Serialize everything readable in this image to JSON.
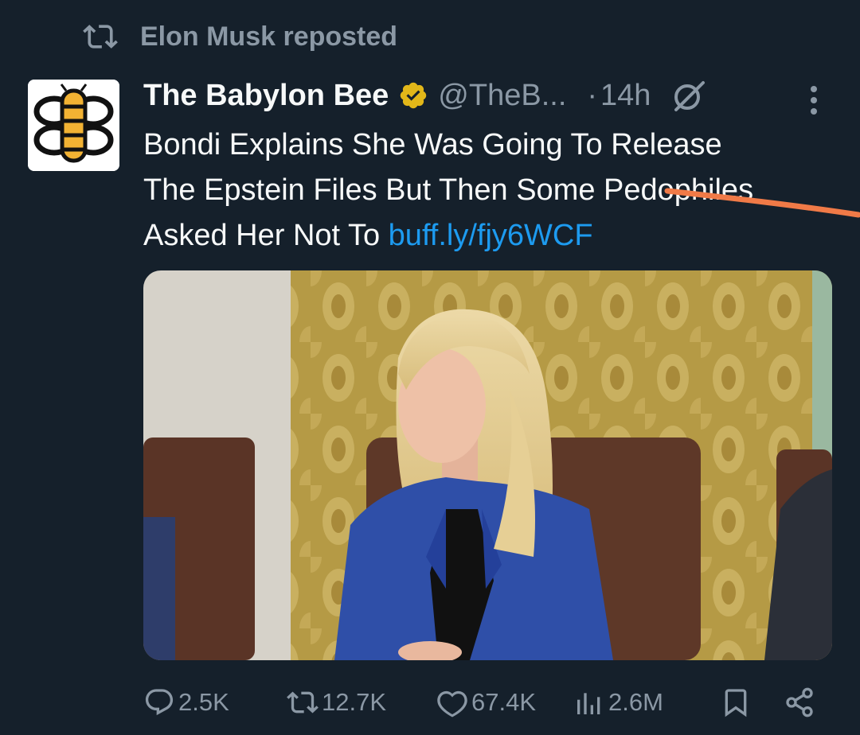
{
  "repost": {
    "icon": "repost-icon",
    "text": "Elon Musk reposted"
  },
  "tweet": {
    "avatar_icon": "babylon-bee-logo",
    "display_name": "The Babylon Bee",
    "verified_icon": "verified-gold-badge",
    "handle": "@TheB...",
    "dot": "·",
    "time": "14h",
    "grok_icon": "grok-icon",
    "more_icon": "more-vertical-icon",
    "text_lines": [
      "Bondi Explains She Was Going To Release",
      "The Epstein Files But Then Some Pedophiles",
      "Asked Her Not To"
    ],
    "link": "buff.ly/fjy6WCF",
    "media_alt_icon": "photo",
    "annotation_color": "#f07a47"
  },
  "actions": {
    "reply": {
      "icon": "reply-icon",
      "count": "2.5K"
    },
    "repost": {
      "icon": "repost-icon",
      "count": "12.7K"
    },
    "like": {
      "icon": "heart-icon",
      "count": "67.4K"
    },
    "views": {
      "icon": "views-icon",
      "count": "2.6M"
    },
    "bookmark": {
      "icon": "bookmark-icon"
    },
    "share": {
      "icon": "share-icon"
    }
  },
  "colors": {
    "background": "#15202b",
    "text": "#f7f9f9",
    "muted": "#8b98a5",
    "link": "#1d9bf0",
    "verified": "#e2b719"
  }
}
